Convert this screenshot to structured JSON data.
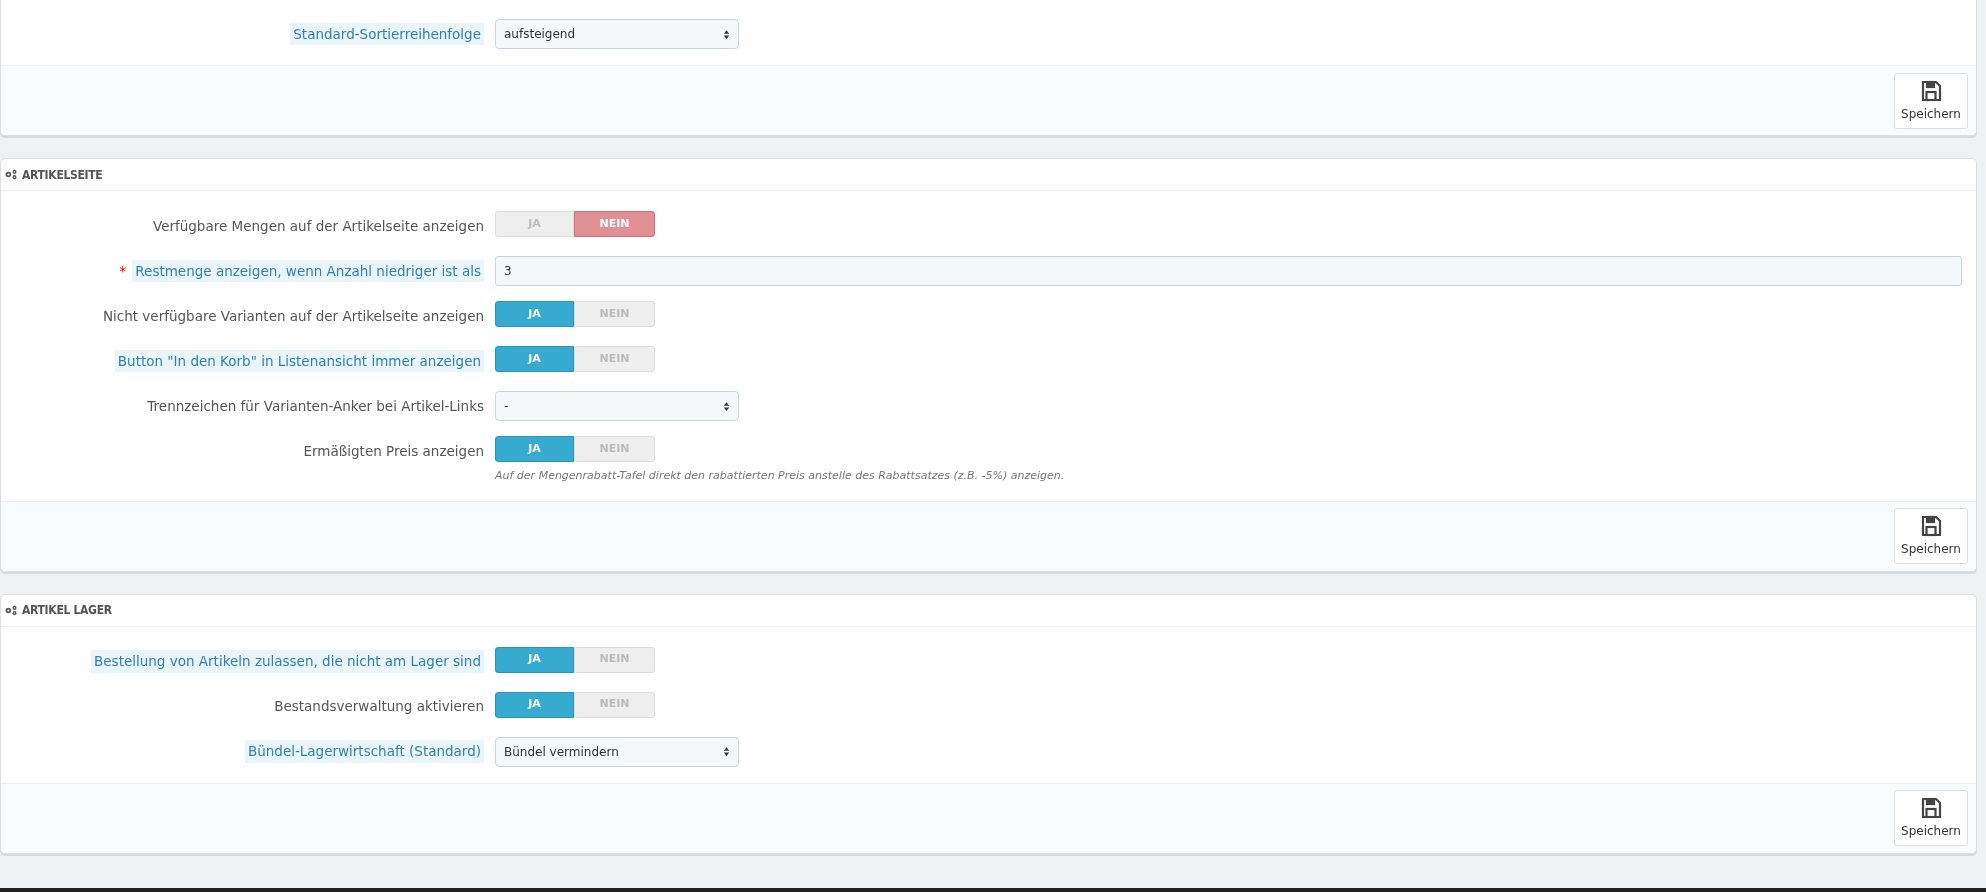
{
  "panels": [
    {
      "rows": [
        {
          "kind": "select",
          "label": "Standard-Sortierreihenfolge",
          "hint": true,
          "value": "aufsteigend"
        }
      ],
      "save": "Speichern"
    },
    {
      "title": "ARTIKELSEITE",
      "rows": [
        {
          "kind": "toggle",
          "label": "Verfügbare Mengen auf der Artikelseite anzeigen",
          "hint": false,
          "on": false,
          "yes": "JA",
          "no": "NEIN"
        },
        {
          "kind": "text",
          "label": "Restmenge anzeigen, wenn Anzahl niedriger ist als",
          "hint": true,
          "star": "*",
          "value": "3"
        },
        {
          "kind": "toggle",
          "label": "Nicht verfügbare Varianten auf der Artikelseite anzeigen",
          "hint": false,
          "on": true,
          "yes": "JA",
          "no": "NEIN"
        },
        {
          "kind": "toggle",
          "label": "Button \"In den Korb\" in Listenansicht immer anzeigen",
          "hint": true,
          "on": true,
          "yes": "JA",
          "no": "NEIN"
        },
        {
          "kind": "select",
          "label": "Trennzeichen für Varianten-Anker bei Artikel-Links",
          "hint": false,
          "value": "-"
        },
        {
          "kind": "toggle",
          "label": "Ermäßigten Preis anzeigen",
          "hint": false,
          "on": true,
          "yes": "JA",
          "no": "NEIN",
          "help": "Auf der Mengenrabatt-Tafel direkt den rabattierten Preis anstelle des Rabattsatzes (z.B. -5%) anzeigen."
        }
      ],
      "save": "Speichern"
    },
    {
      "title": "ARTIKEL LAGER",
      "rows": [
        {
          "kind": "toggle",
          "label": "Bestellung von Artikeln zulassen, die nicht am Lager sind",
          "hint": true,
          "on": true,
          "yes": "JA",
          "no": "NEIN"
        },
        {
          "kind": "toggle",
          "label": "Bestandsverwaltung aktivieren",
          "hint": false,
          "on": true,
          "yes": "JA",
          "no": "NEIN"
        },
        {
          "kind": "select",
          "label": "Bündel-Lagerwirtschaft (Standard)",
          "hint": true,
          "value": "Bündel vermindern"
        }
      ],
      "save": "Speichern"
    }
  ]
}
